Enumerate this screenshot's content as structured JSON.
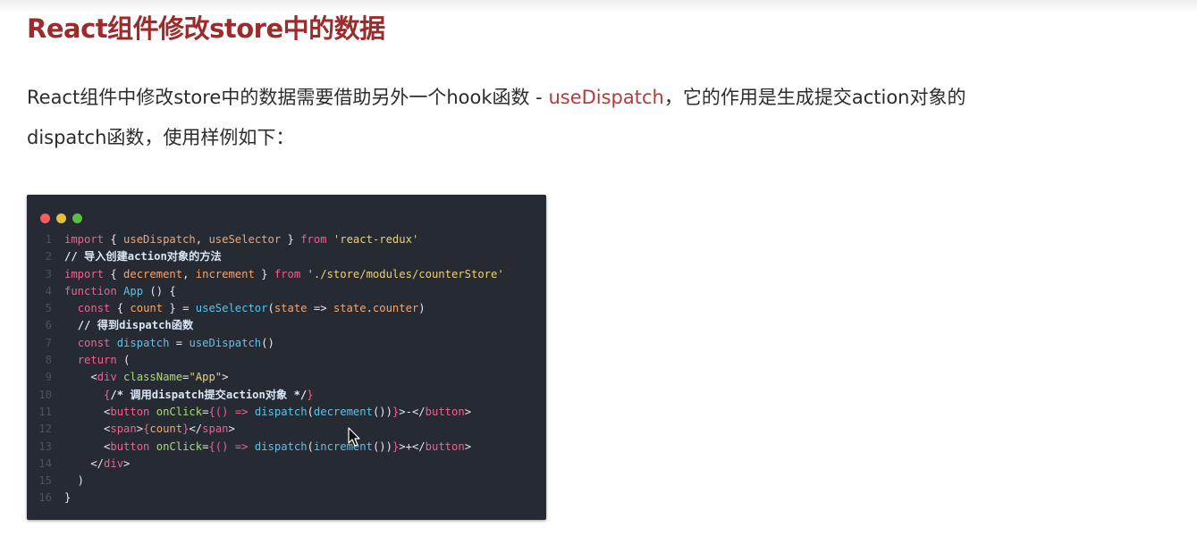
{
  "title": "React组件修改store中的数据",
  "paragraph": {
    "before": "React组件中修改store中的数据需要借助另外一个hook函数 - ",
    "highlight": "useDispatch",
    "after_line1": "，它的作用是生成提交action对象的",
    "line2": "dispatch函数，使用样例如下："
  },
  "code": {
    "lines": [
      [
        {
          "t": "import",
          "c": "kw"
        },
        {
          "t": " { "
        },
        {
          "t": "useDispatch",
          "c": "id"
        },
        {
          "t": ", "
        },
        {
          "t": "useSelector",
          "c": "id"
        },
        {
          "t": " } "
        },
        {
          "t": "from",
          "c": "kw"
        },
        {
          "t": " "
        },
        {
          "t": "'react-redux'",
          "c": "str"
        }
      ],
      [
        {
          "t": "// 导入创建action对象的方法",
          "c": "cm"
        }
      ],
      [
        {
          "t": "import",
          "c": "kw"
        },
        {
          "t": " { "
        },
        {
          "t": "decrement",
          "c": "id"
        },
        {
          "t": ", "
        },
        {
          "t": "increment",
          "c": "id"
        },
        {
          "t": " } "
        },
        {
          "t": "from",
          "c": "kw"
        },
        {
          "t": " "
        },
        {
          "t": "'./store/modules/counterStore'",
          "c": "str"
        }
      ],
      [
        {
          "t": "function",
          "c": "kw"
        },
        {
          "t": " "
        },
        {
          "t": "App",
          "c": "fn"
        },
        {
          "t": " () {"
        }
      ],
      [
        {
          "t": "  "
        },
        {
          "t": "const",
          "c": "kw"
        },
        {
          "t": " { "
        },
        {
          "t": "count",
          "c": "id"
        },
        {
          "t": " } = "
        },
        {
          "t": "useSelector",
          "c": "fn"
        },
        {
          "t": "("
        },
        {
          "t": "state",
          "c": "id"
        },
        {
          "t": " => "
        },
        {
          "t": "state",
          "c": "id"
        },
        {
          "t": "."
        },
        {
          "t": "counter",
          "c": "id"
        },
        {
          "t": ")"
        }
      ],
      [
        {
          "t": "  "
        },
        {
          "t": "// 得到dispatch函数",
          "c": "cm"
        }
      ],
      [
        {
          "t": "  "
        },
        {
          "t": "const",
          "c": "kw"
        },
        {
          "t": " "
        },
        {
          "t": "dispatch",
          "c": "fn"
        },
        {
          "t": " = "
        },
        {
          "t": "useDispatch",
          "c": "fn"
        },
        {
          "t": "()"
        }
      ],
      [
        {
          "t": "  "
        },
        {
          "t": "return",
          "c": "kw"
        },
        {
          "t": " ("
        }
      ],
      [
        {
          "t": "    <"
        },
        {
          "t": "div",
          "c": "tag"
        },
        {
          "t": " "
        },
        {
          "t": "className",
          "c": "attr"
        },
        {
          "t": "="
        },
        {
          "t": "\"App\"",
          "c": "str"
        },
        {
          "t": ">"
        }
      ],
      [
        {
          "t": "      "
        },
        {
          "t": "{",
          "c": "kw"
        },
        {
          "t": "/* 调用dispatch提交action对象 */",
          "c": "cm"
        },
        {
          "t": "}",
          "c": "kw"
        }
      ],
      [
        {
          "t": "      <"
        },
        {
          "t": "button",
          "c": "tag"
        },
        {
          "t": " "
        },
        {
          "t": "onClick",
          "c": "attr"
        },
        {
          "t": "="
        },
        {
          "t": "{() => ",
          "c": "kw"
        },
        {
          "t": "dispatch",
          "c": "fn"
        },
        {
          "t": "("
        },
        {
          "t": "decrement",
          "c": "fn"
        },
        {
          "t": "())"
        },
        {
          "t": "}",
          "c": "kw"
        },
        {
          "t": ">-</"
        },
        {
          "t": "button",
          "c": "tag"
        },
        {
          "t": ">"
        }
      ],
      [
        {
          "t": "      <"
        },
        {
          "t": "span",
          "c": "tag"
        },
        {
          "t": ">"
        },
        {
          "t": "{",
          "c": "kw"
        },
        {
          "t": "count",
          "c": "id"
        },
        {
          "t": "}",
          "c": "kw"
        },
        {
          "t": "</"
        },
        {
          "t": "span",
          "c": "tag"
        },
        {
          "t": ">"
        }
      ],
      [
        {
          "t": "      <"
        },
        {
          "t": "button",
          "c": "tag"
        },
        {
          "t": " "
        },
        {
          "t": "onClick",
          "c": "attr"
        },
        {
          "t": "="
        },
        {
          "t": "{() => ",
          "c": "kw"
        },
        {
          "t": "dispatch",
          "c": "fn"
        },
        {
          "t": "("
        },
        {
          "t": "increment",
          "c": "fn"
        },
        {
          "t": "())"
        },
        {
          "t": "}",
          "c": "kw"
        },
        {
          "t": ">+</"
        },
        {
          "t": "button",
          "c": "tag"
        },
        {
          "t": ">"
        }
      ],
      [
        {
          "t": "    </"
        },
        {
          "t": "div",
          "c": "tag"
        },
        {
          "t": ">"
        }
      ],
      [
        {
          "t": "  )"
        }
      ],
      [
        {
          "t": "}"
        }
      ]
    ]
  },
  "colors": {
    "title": "#9c2b2b",
    "highlight": "#b53a3a",
    "code_background": "#262a33",
    "keyword": "#f0618d",
    "function": "#5ec2e6",
    "identifier": "#f8a46b",
    "string": "#edd174"
  }
}
